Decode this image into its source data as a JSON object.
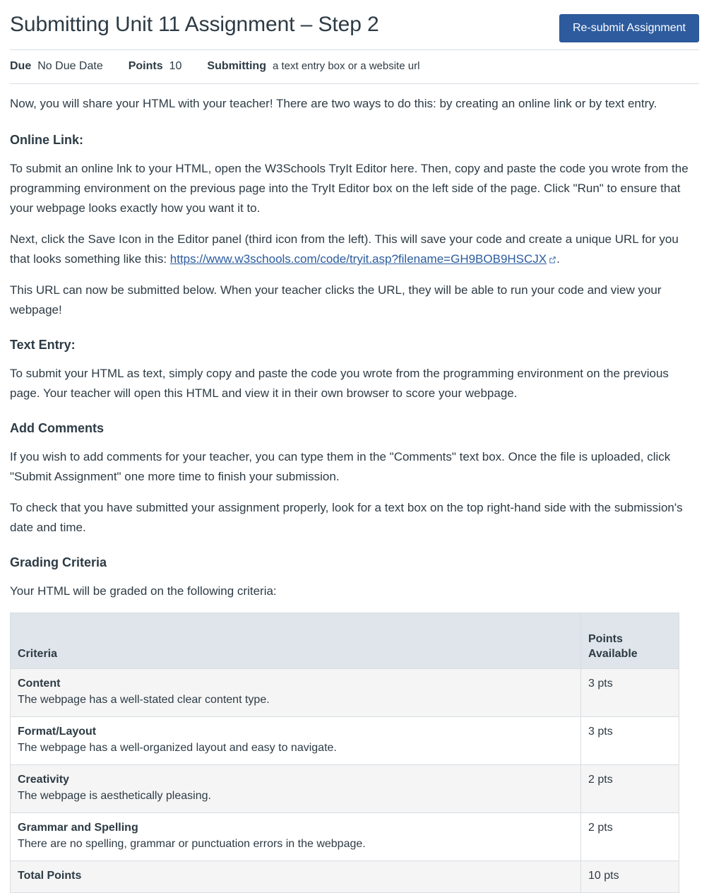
{
  "header": {
    "title": "Submitting Unit 11 Assignment – Step 2",
    "resubmit_label": "Re-submit Assignment"
  },
  "meta": {
    "due_label": "Due",
    "due_value": "No Due Date",
    "points_label": "Points",
    "points_value": "10",
    "submitting_label": "Submitting",
    "submitting_value": "a text entry box or a website url"
  },
  "content": {
    "intro": "Now, you will share your HTML with your teacher! There are two ways to do this: by creating an online link or by text entry.",
    "online_link_heading": "Online Link:",
    "online_link_p1": "To submit an online lnk to your HTML, open the W3Schools TryIt Editor here.  Then, copy and paste the code you wrote from the programming environment on the previous page into the TryIt Editor box on the left side of the page. Click \"Run\" to ensure that your webpage looks exactly how you want it to.",
    "online_link_p2_before": "Next, click the Save Icon in the Editor panel (third icon from the left). This will save your code and create a unique URL for you that looks something like this: ",
    "online_link_url": "https://www.w3schools.com/code/tryit.asp?filename=GH9BOB9HSCJX",
    "online_link_p2_after": ".",
    "online_link_p3": "This URL can now be submitted below. When your teacher clicks the URL, they will be able to run your code and view your webpage!",
    "text_entry_heading": "Text Entry:",
    "text_entry_p1": "To submit your HTML as text, simply copy and paste the code you wrote from the programming environment on the previous page. Your teacher will open this HTML and view it in their own browser to score your webpage.",
    "add_comments_heading": "Add Comments",
    "add_comments_p1": "If you wish to add comments for your teacher, you can type them in the \"Comments\" text box. Once the file is uploaded, click \"Submit Assignment\" one more time to finish your submission.",
    "add_comments_p2": "To check that you have submitted your assignment properly, look for a text box on the top right-hand side with the submission's date and time.",
    "grading_heading": "Grading Criteria",
    "grading_intro": "Your HTML will be graded on the following criteria:"
  },
  "rubric": {
    "columns": [
      "Criteria",
      "Points Available"
    ],
    "rows": [
      {
        "name": "Content",
        "desc": "The webpage has a well-stated clear content type.",
        "points": "3 pts"
      },
      {
        "name": "Format/Layout",
        "desc": "The webpage has a well-organized layout and easy to navigate.",
        "points": "3 pts"
      },
      {
        "name": "Creativity",
        "desc": "The webpage is aesthetically pleasing.",
        "points": "2 pts"
      },
      {
        "name": "Grammar and Spelling",
        "desc": "There are no spelling, grammar or punctuation errors in the webpage.",
        "points": "2 pts"
      },
      {
        "name": "Total Points",
        "desc": "",
        "points": "10 pts"
      }
    ]
  },
  "colors": {
    "accent_blue": "#2d5b9e",
    "link_blue": "#2b5c9e",
    "text": "#2d3b45",
    "table_header_bg": "#dfe5ea",
    "row_alt_bg": "#f5f5f5",
    "border": "#d8dde2"
  }
}
